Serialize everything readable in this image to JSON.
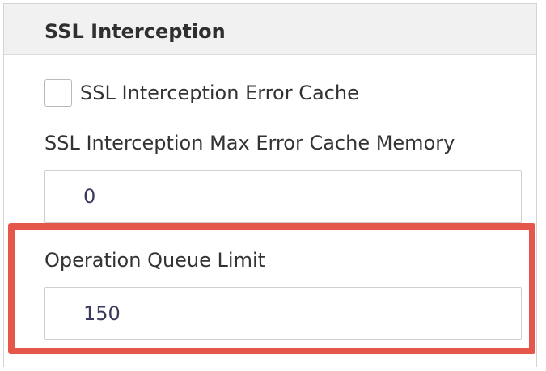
{
  "section": {
    "title": "SSL Interception"
  },
  "error_cache": {
    "label": "SSL Interception Error Cache",
    "checked": false
  },
  "max_error_cache_memory": {
    "label": "SSL Interception Max Error Cache Memory",
    "value": "0"
  },
  "operation_queue_limit": {
    "label": "Operation Queue Limit",
    "value": "150"
  },
  "colors": {
    "highlight": "#e5574a",
    "header_background": "#f1f1f1",
    "input_text": "#3a3a5a"
  }
}
